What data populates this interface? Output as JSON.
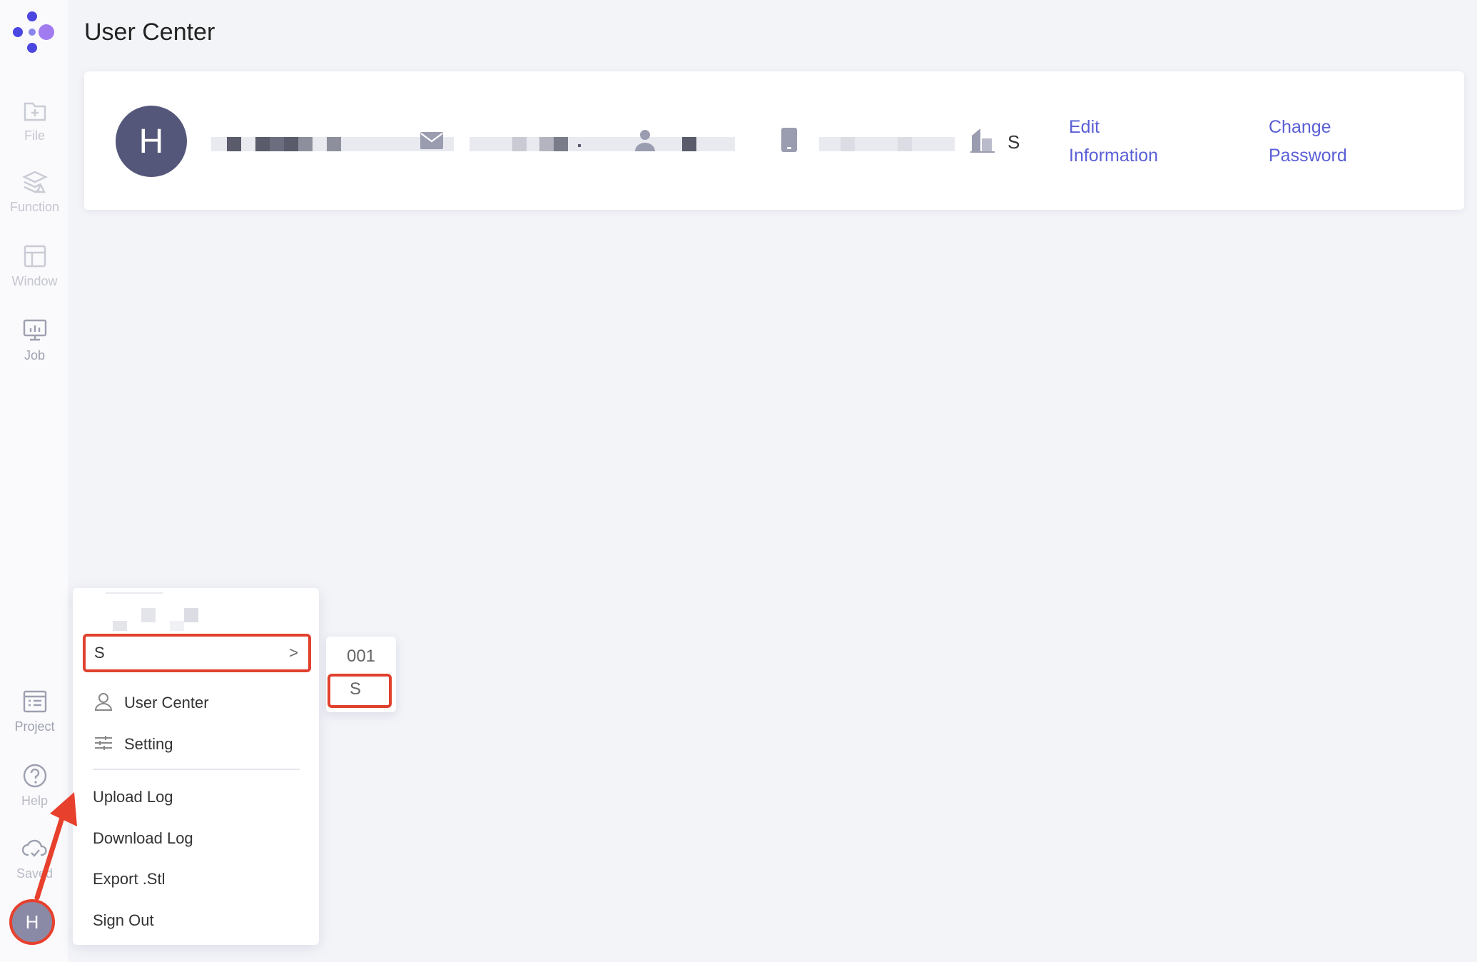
{
  "page": {
    "title": "User Center"
  },
  "sidebar": {
    "items": [
      {
        "label": "File",
        "icon": "file-add-icon"
      },
      {
        "label": "Function",
        "icon": "layers-icon"
      },
      {
        "label": "Window",
        "icon": "layout-icon"
      },
      {
        "label": "Job",
        "icon": "monitor-chart-icon"
      }
    ],
    "bottom_items": [
      {
        "label": "Project",
        "icon": "list-icon"
      },
      {
        "label": "Help",
        "icon": "help-icon"
      },
      {
        "label": "Saved",
        "icon": "cloud-check-icon"
      }
    ],
    "avatar_letter": "H"
  },
  "user_card": {
    "avatar_letter": "H",
    "company": "S",
    "edit_link": {
      "line1": "Edit",
      "line2": "Information"
    },
    "password_link": {
      "line1": "Change",
      "line2": "Password"
    }
  },
  "menu": {
    "organization": "S",
    "items": {
      "user_center": "User Center",
      "setting": "Setting",
      "upload_log": "Upload Log",
      "download_log": "Download Log",
      "export_stl": "Export .Stl",
      "sign_out": "Sign Out"
    }
  },
  "submenu": {
    "items": [
      "001",
      "S"
    ]
  },
  "colors": {
    "accent": "#5a5fd6",
    "highlight": "#e0412d",
    "avatar": "#55577a"
  }
}
